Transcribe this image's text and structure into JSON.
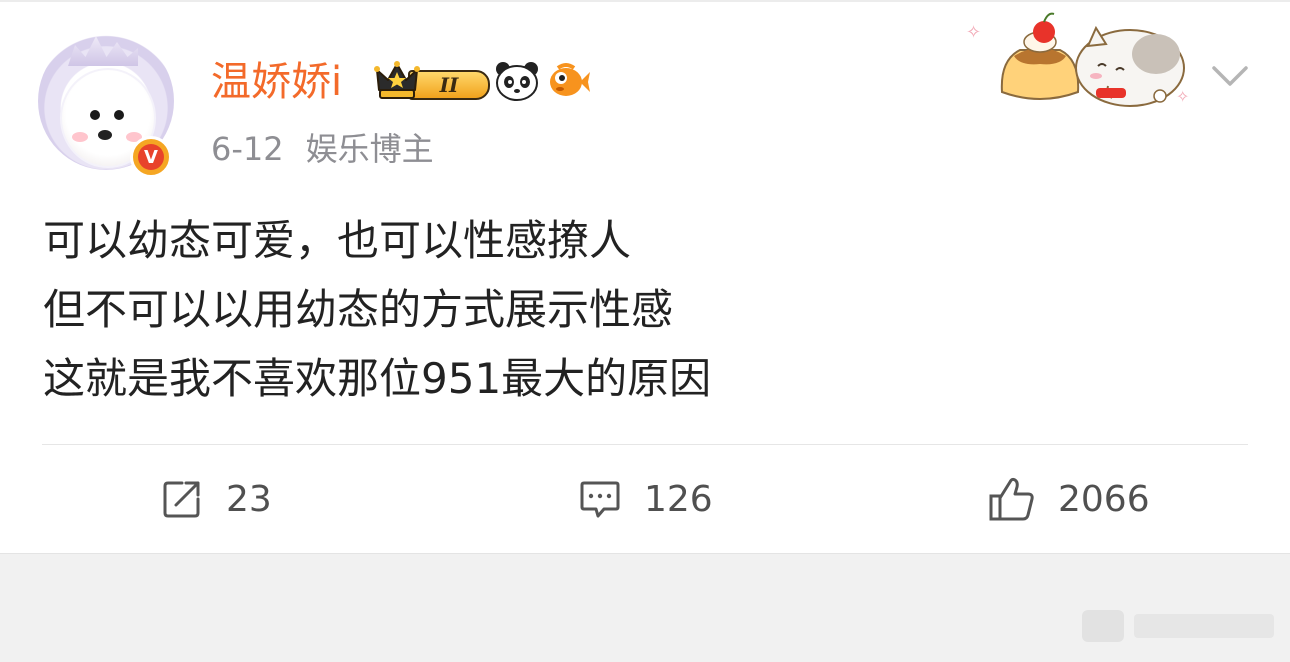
{
  "post": {
    "author": {
      "name": "温娇娇i",
      "level_badge": "II",
      "verified_icon": "v-badge-icon"
    },
    "meta": {
      "date": "6-12",
      "category": "娱乐博主"
    },
    "content_lines": [
      "可以幼态可爱，也可以性感撩人",
      "但不可以以用幼态的方式展示性感",
      "这就是我不喜欢那位951最大的原因"
    ],
    "actions": {
      "repost": {
        "icon": "share-icon",
        "count": "23"
      },
      "comment": {
        "icon": "comment-icon",
        "count": "126"
      },
      "like": {
        "icon": "thumbs-up-icon",
        "count": "2066"
      }
    }
  },
  "colors": {
    "username": "#f36a2a",
    "meta_text": "#8e8e93",
    "body_text": "#222222",
    "action_text": "#505050",
    "background": "#f1f1f1"
  }
}
